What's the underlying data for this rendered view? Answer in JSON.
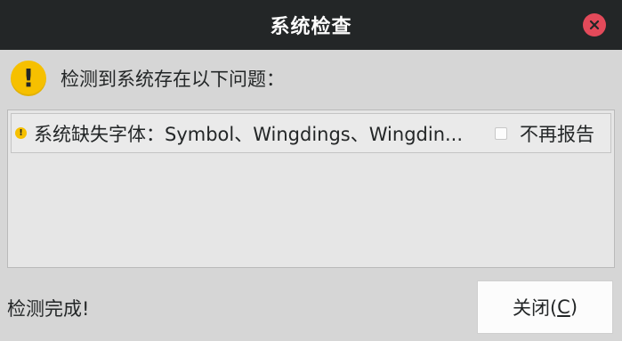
{
  "window": {
    "title": "系统检查"
  },
  "header": {
    "icon": "warning-icon",
    "icon_glyph": "!",
    "message": "检测到系统存在以下问题："
  },
  "issues": [
    {
      "icon": "warning-small-icon",
      "icon_glyph": "!",
      "text": "系统缺失字体：Symbol、Wingdings、Wingdin...",
      "checkbox_label": "不再报告",
      "checked": false
    }
  ],
  "footer": {
    "status": "检测完成!",
    "close_button": {
      "label_prefix": "关闭(",
      "mnemonic": "C",
      "label_suffix": ")"
    }
  },
  "colors": {
    "titlebar": "#232627",
    "window_bg": "#d6d6d6",
    "close_icon": "#e34a5a",
    "warning": "#f6c000"
  }
}
